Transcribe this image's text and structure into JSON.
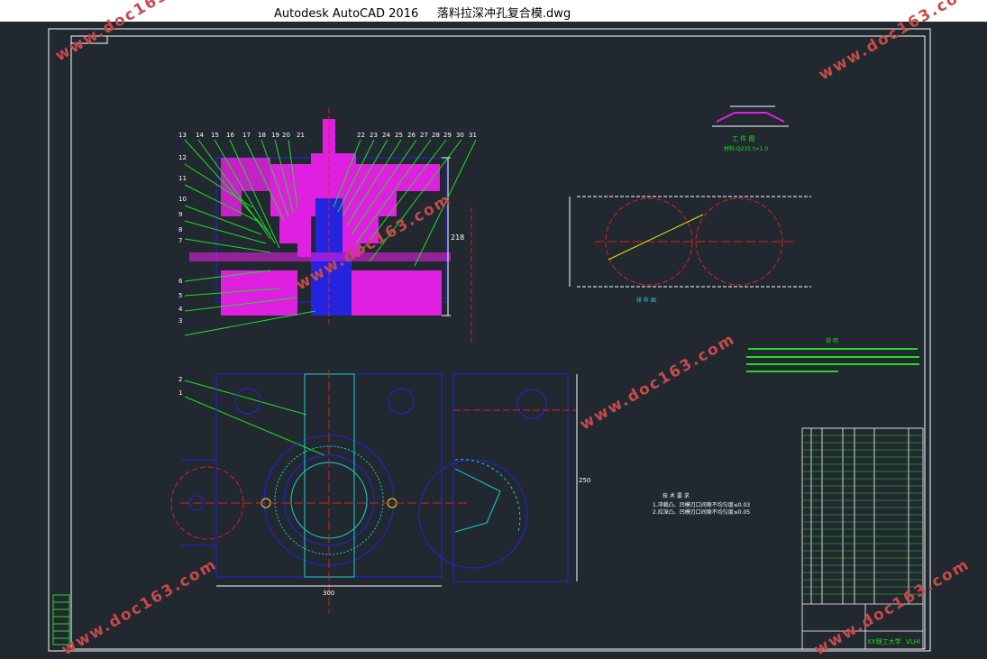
{
  "window": {
    "app_name": "Autodesk AutoCAD 2016",
    "file_name": "落料拉深冲孔复合模.dwg"
  },
  "watermark": {
    "text": "www.doc163.com"
  },
  "drawing": {
    "part_label": "工 件 图",
    "part_material": "材料:Q235  t=1.0",
    "tech_title": "技 术 要 求",
    "tech_line1": "1.冲裁凸、凹模刃口间隙不均匀度≤0.03",
    "tech_line2": "2.拉深凸、凹模刃口间隙不均匀度≤0.05",
    "notes_title": "说  明",
    "dim_front": "300",
    "dim_height": "218",
    "dim_side": "250",
    "callouts_top": [
      "13",
      "14",
      "15",
      "16",
      "17",
      "18",
      "19",
      "20",
      "21",
      "22",
      "23",
      "24",
      "25",
      "26",
      "27",
      "28",
      "29",
      "30",
      "31"
    ],
    "callouts_left": [
      "12",
      "11",
      "10",
      "9",
      "8",
      "7",
      "6",
      "5",
      "4",
      "3"
    ],
    "callouts_plan": [
      "2",
      "1"
    ],
    "tb_school": "XX理工大学",
    "tb_code": "VLHI"
  },
  "colors": {
    "bg": "#212830",
    "frame": "#ffffff",
    "magenta": "#e020e0",
    "blue": "#2424e0",
    "green": "#22dd22",
    "yellow": "#e8e800",
    "red": "#e02020",
    "cyan": "#20d0d0",
    "watermark": "#c74a4a"
  }
}
